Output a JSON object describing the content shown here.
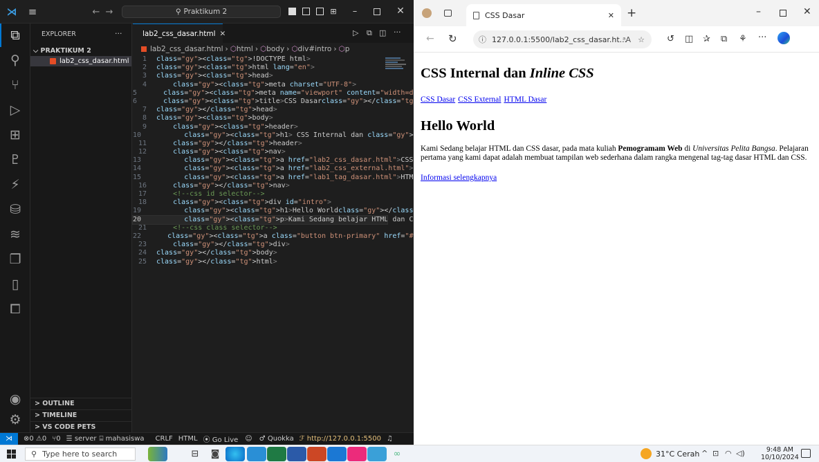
{
  "vscode": {
    "search_label": "Praktikum 2",
    "sidebar_title": "EXPLORER",
    "folder": "PRAKTIKUM 2",
    "file": "lab2_css_dasar.html",
    "outline": "OUTLINE",
    "timeline": "TIMELINE",
    "pets": "VS CODE PETS",
    "tab": "lab2_css_dasar.html",
    "crumbs": [
      "lab2_css_dasar.html",
      "html",
      "body",
      "div#intro",
      "p"
    ],
    "lines": [
      "<!DOCTYPE html>",
      "<html lang=\"en\">",
      "<head>",
      "    <meta charset=\"UTF-8\">",
      "    <meta name=\"viewport\" content=\"width=device-widt",
      "    <title>CSS Dasar</title>",
      "</head>",
      "<body>",
      "    <header>",
      "        <h1> CSS Internal dan <i> Inline CSS</i></h1",
      "    </header>",
      "    <nav>",
      "        <a href=\"lab2_css_dasar.html\">CSS Dasar</a>",
      "        <a href=\"lab2_css_external.html\">CSS Externa",
      "        <a href=\"lab1_tag_dasar.html\">HTML Dasar</a>",
      "    </nav>",
      "    <!--css id selector-->",
      "    <div id=\"intro\">",
      "        <h1>Hello World</h1>",
      "        <p>Kami Sedang belajar HTML dan CSS dasar, p",
      "    <!--css class selector-->",
      "    <a class=\"button btn-primary\" href=\"#intro\"> Inf",
      "    </div>",
      "</body>",
      "</html>"
    ],
    "current_line": 20,
    "status": {
      "errors": "0",
      "warnings": "0",
      "ports": "0",
      "server": "server",
      "user": "mahasiswa",
      "eol": "CRLF",
      "lang": "HTML",
      "golive": "Go Live",
      "quokka": "Quokka",
      "url": "http://127.0.0.1:5500"
    }
  },
  "browser": {
    "tab_title": "CSS Dasar",
    "url": "127.0.0.1:5500/lab2_css_dasar.ht...",
    "page": {
      "title_plain": "CSS Internal dan ",
      "title_italic": "Inline CSS",
      "nav": [
        "CSS Dasar",
        "CSS External",
        "HTML Dasar"
      ],
      "heading": "Hello World",
      "para_a": "Kami Sedang belajar HTML dan CSS dasar, pada mata kuliah ",
      "para_b": "Pemogramam Web",
      "para_c": " di ",
      "para_d": "Universitas Pelita Bangsa",
      "para_e": ". Pelajaran pertama yang kami dapat adalah membuat tampilan web sederhana dalam rangka mengenal tag-tag dasar HTML dan CSS.",
      "link": "Informasi selengkapnya"
    }
  },
  "taskbar": {
    "search_placeholder": "Type here to search",
    "weather": "31°C  Cerah",
    "time": "9:48 AM",
    "date": "10/10/2024"
  }
}
